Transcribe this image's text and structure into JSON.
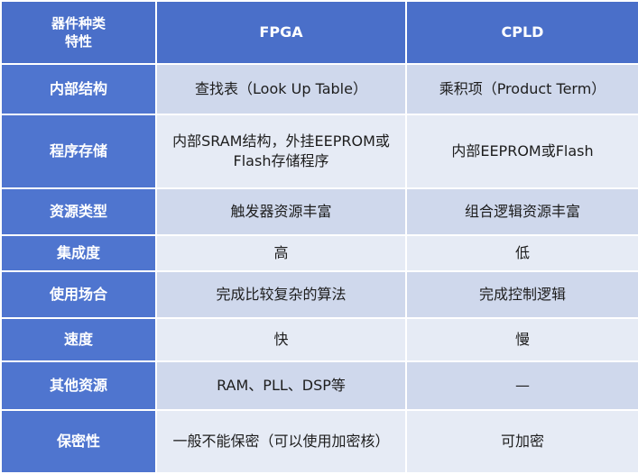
{
  "header": {
    "corner_line1": "器件种类",
    "corner_line2": "特性",
    "col_fpga": "FPGA",
    "col_cpld": "CPLD"
  },
  "rows": [
    {
      "label": "内部结构",
      "fpga": "查找表（Look Up Table）",
      "cpld": "乘积项（Product Term）"
    },
    {
      "label": "程序存储",
      "fpga": "内部SRAM结构，外挂EEPROM或Flash存储程序",
      "cpld": "内部EEPROM或Flash"
    },
    {
      "label": "资源类型",
      "fpga": "触发器资源丰富",
      "cpld": "组合逻辑资源丰富"
    },
    {
      "label": "集成度",
      "fpga": "高",
      "cpld": "低"
    },
    {
      "label": "使用场合",
      "fpga": "完成比较复杂的算法",
      "cpld": "完成控制逻辑"
    },
    {
      "label": "速度",
      "fpga": "快",
      "cpld": "慢"
    },
    {
      "label": "其他资源",
      "fpga": "RAM、PLL、DSP等",
      "cpld": "—"
    },
    {
      "label": "保密性",
      "fpga": "一般不能保密（可以使用加密核）",
      "cpld": "可加密"
    }
  ]
}
